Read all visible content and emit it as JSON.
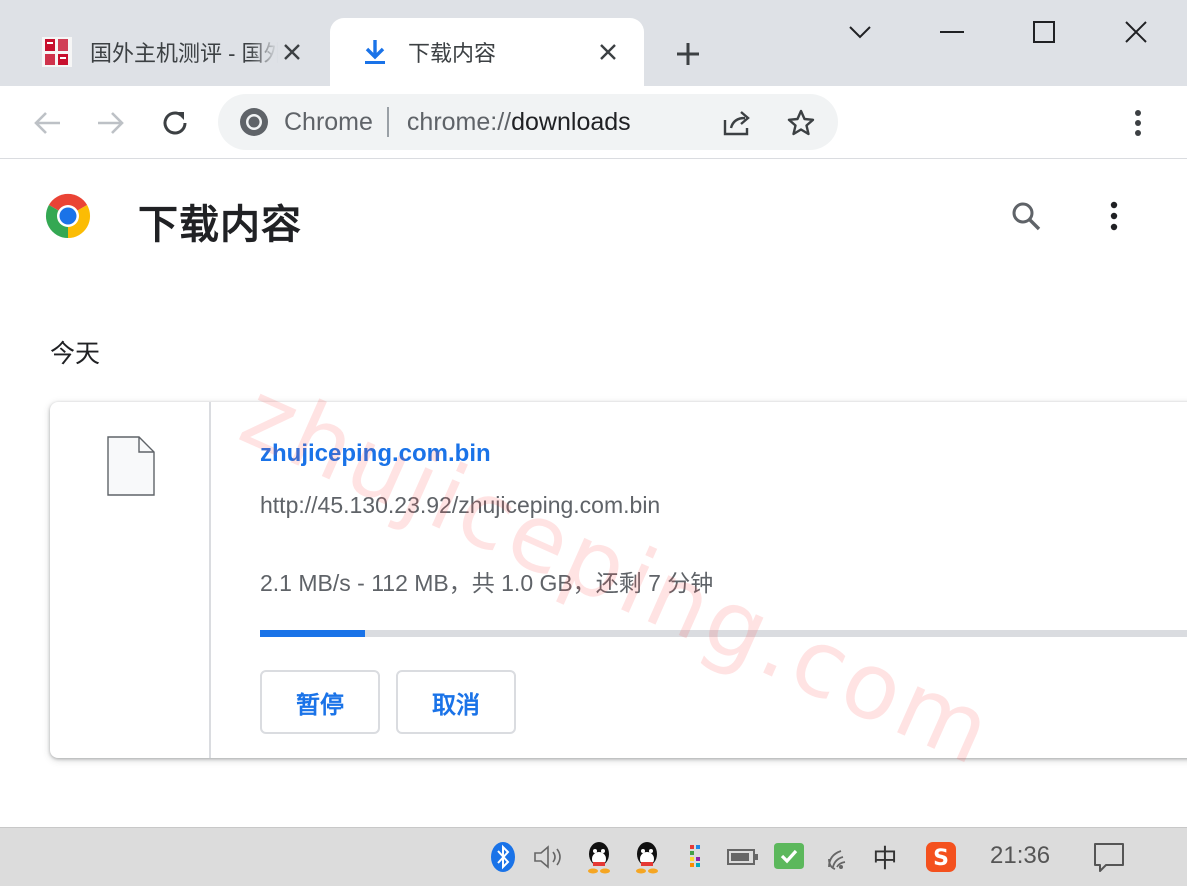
{
  "tabs": [
    {
      "title": "国外主机测评 - 国外VPS，",
      "active": false
    },
    {
      "title": "下载内容",
      "active": true
    }
  ],
  "window_controls": [
    "tab-search",
    "minimize",
    "maximize",
    "close"
  ],
  "toolbar": {
    "site_label": "Chrome",
    "url_scheme": "chrome://",
    "url_path": "downloads"
  },
  "page": {
    "title": "下载内容",
    "section_date": "今天",
    "watermark": "zhujiceping.com"
  },
  "download": {
    "file_name": "zhujiceping.com.bin",
    "url": "http://45.130.23.92/zhujiceping.com.bin",
    "status": "2.1 MB/s - 112 MB，共 1.0 GB，还剩 7 分钟",
    "progress": 0.11,
    "pause_label": "暂停",
    "cancel_label": "取消"
  },
  "taskbar": {
    "ime_label": "中",
    "clock": "21:36"
  },
  "colors": {
    "accent": "#1a73e8",
    "tabstrip_bg": "#dee1e6",
    "omnibox_bg": "#f1f3f4",
    "taskbar_bg": "#dcdcdc",
    "watermark": "#ff5050"
  },
  "icons": [
    "favicon-zhujiceping-icon",
    "download-arrow-icon",
    "close-icon",
    "plus-icon",
    "chevron-down-icon",
    "minimize-icon",
    "maximize-icon",
    "back-arrow-icon",
    "forward-arrow-icon",
    "reload-icon",
    "chrome-logo-icon",
    "share-icon",
    "star-icon",
    "kebab-menu-icon",
    "search-icon",
    "file-icon",
    "bluetooth-icon",
    "volume-icon",
    "qq-icon",
    "battery-icon",
    "wechat-icon",
    "wifi-icon",
    "sogou-icon",
    "notification-icon"
  ]
}
